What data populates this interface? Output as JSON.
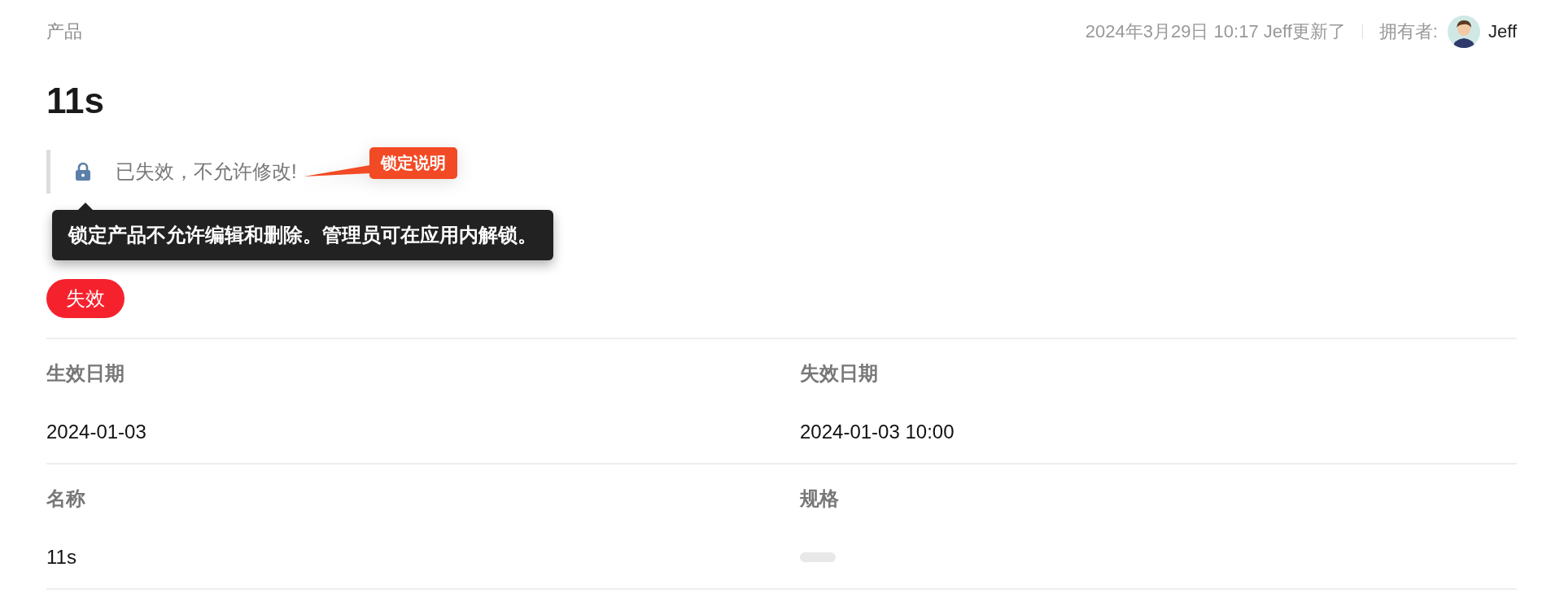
{
  "breadcrumb": "产品",
  "meta": {
    "updated": "2024年3月29日 10:17 Jeff更新了",
    "owner_label": "拥有者:",
    "owner_name": "Jeff"
  },
  "title": "11s",
  "lock_notice": {
    "text": "已失效，不允许修改!",
    "callout": "锁定说明",
    "tooltip": "锁定产品不允许编辑和删除。管理员可在应用内解锁。"
  },
  "status": {
    "label": "失效",
    "color": "#f5222d"
  },
  "fields": [
    {
      "label": "生效日期",
      "value": "2024-01-03",
      "kind": "text"
    },
    {
      "label": "失效日期",
      "value": "2024-01-03 10:00",
      "kind": "text"
    },
    {
      "label": "名称",
      "value": "11s",
      "kind": "text"
    },
    {
      "label": "规格",
      "kind": "empty"
    }
  ]
}
